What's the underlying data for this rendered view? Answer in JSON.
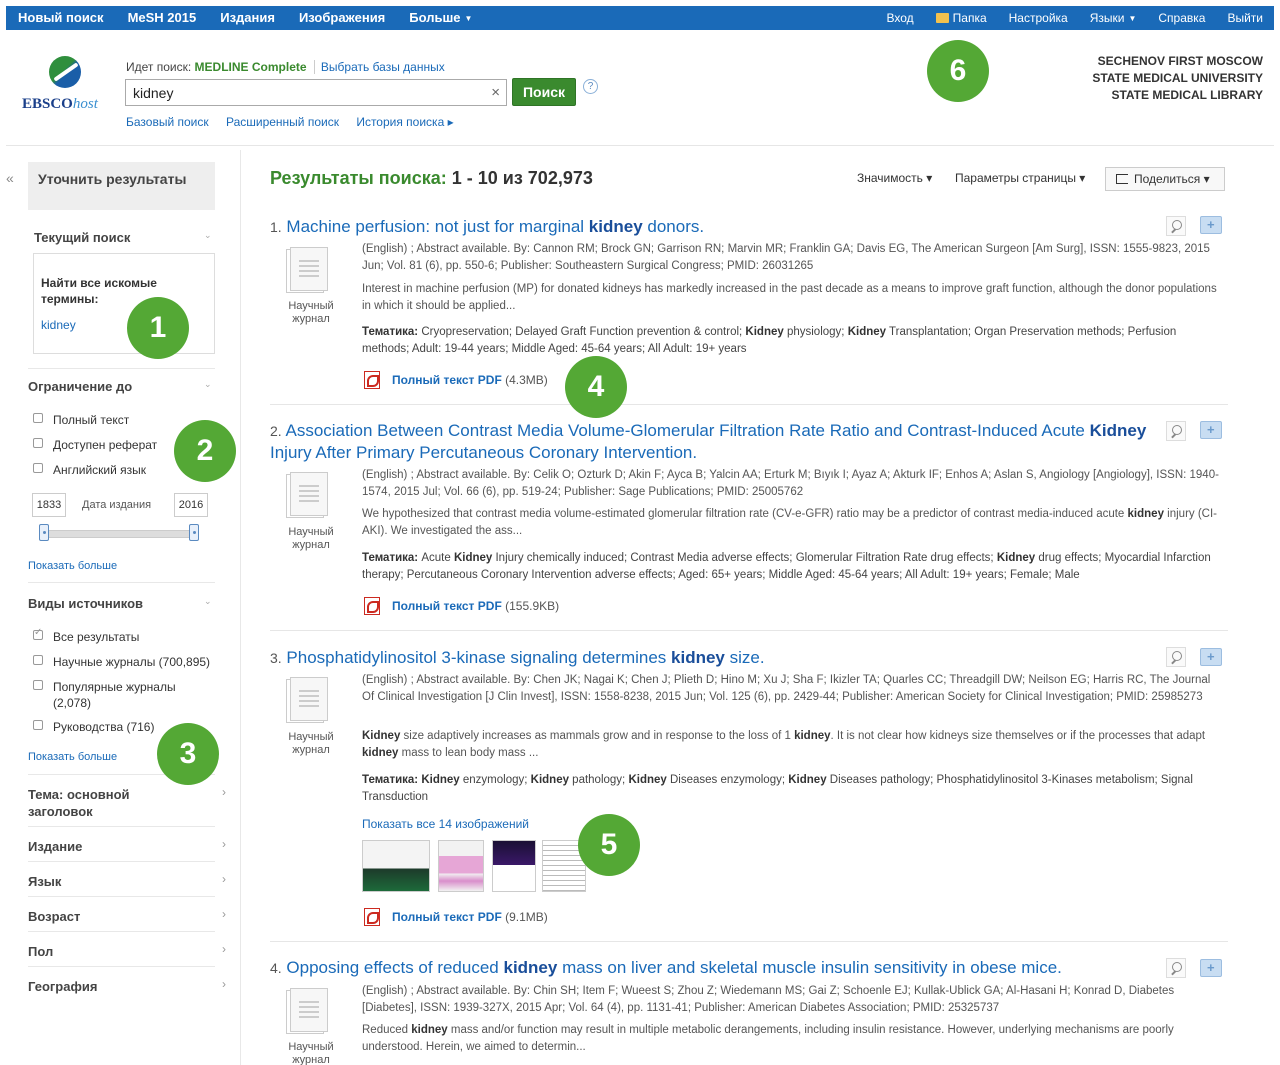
{
  "topnav": {
    "left": [
      "Новый поиск",
      "MeSH 2015",
      "Издания",
      "Изображения",
      "Больше"
    ],
    "right": [
      "Вход",
      "Папка",
      "Настройка",
      "Языки",
      "Справка",
      "Выйти"
    ]
  },
  "header": {
    "logo_main": "EBSCO",
    "logo_host": "host",
    "searching_prefix": "Идет поиск:",
    "database": "MEDLINE Complete",
    "choose_db": "Выбрать базы данных",
    "query": "kidney",
    "clear_glyph": "×",
    "search_button": "Поиск",
    "help_glyph": "?",
    "links": [
      "Базовый поиск",
      "Расширенный поиск",
      "История поиска ▸"
    ],
    "institution": [
      "SECHENOV FIRST MOSCOW",
      "STATE MEDICAL UNIVERSITY",
      "STATE MEDICAL LIBRARY"
    ]
  },
  "badges": [
    "1",
    "2",
    "3",
    "4",
    "5",
    "6"
  ],
  "sidebar": {
    "collapse": "«",
    "refine_title": "Уточнить результаты",
    "current_search": "Текущий поиск",
    "find_all_label": "Найти все искомые термины:",
    "term": "kidney",
    "limit_to": "Ограничение до",
    "limits": [
      "Полный текст",
      "Доступен реферат",
      "Английский язык"
    ],
    "date_from": "1833",
    "date_label": "Дата издания",
    "date_to": "2016",
    "show_more": "Показать больше",
    "source_types": "Виды источников",
    "sources": [
      "Все результаты",
      "Научные журналы (700,895)",
      "Популярные журналы",
      "(2,078)",
      "Руководства (716)"
    ],
    "facets": [
      "Тема: основной",
      "заголовок",
      "Издание",
      "Язык",
      "Возраст",
      "Пол",
      "География"
    ],
    "chevron_down": "⌄",
    "chevron_right": "›"
  },
  "results": {
    "title_prefix": "Результаты поиска:",
    "title_count": "1 - 10 из 702,973",
    "sort": "Значимость ▾",
    "page_options": "Параметры страницы ▾",
    "share": "Поделиться ▾",
    "pub_type_line1": "Научный",
    "pub_type_line2": "журнал",
    "pdf_label": "Полный текст PDF",
    "subjects_label": "Тематика:",
    "items": [
      {
        "num": "1.",
        "title_parts": [
          "Machine perfusion: not just for marginal ",
          "kidney",
          " donors."
        ],
        "meta": "(English) ; Abstract available. By: Cannon RM; Brock GN; Garrison RN; Marvin MR; Franklin GA; Davis EG, The American Surgeon [Am Surg], ISSN: 1555-9823, 2015 Jun; Vol. 81 (6), pp. 550-6; Publisher: Southeastern Surgical Congress; PMID: 26031265",
        "abstract": "Interest in machine perfusion (MP) for donated kidneys has markedly increased in the past decade as a means to improve graft function, although the donor populations in which it should be applied...",
        "subjects_parts": [
          "Cryopreservation; Delayed Graft Function prevention & control; ",
          "Kidney",
          " physiology; ",
          "Kidney",
          " Transplantation; Organ Preservation methods; Perfusion methods; Adult: 19-44 years; Middle Aged: 45-64 years; All Adult: 19+ years"
        ],
        "pdf_size": "(4.3MB)"
      },
      {
        "num": "2.",
        "title_parts": [
          "Association Between Contrast Media Volume-Glomerular Filtration Rate Ratio and Contrast-Induced Acute ",
          "Kidney",
          " Injury After Primary Percutaneous Coronary Intervention."
        ],
        "meta": "(English) ; Abstract available. By: Celik O; Ozturk D; Akin F; Ayca B; Yalcin AA; Erturk M; Bıyık I; Ayaz A; Akturk IF; Enhos A; Aslan S, Angiology [Angiology], ISSN: 1940-1574, 2015 Jul; Vol. 66 (6), pp. 519-24; Publisher: Sage Publications; PMID: 25005762",
        "abstract_parts": [
          "We hypothesized that contrast media volume-estimated glomerular filtration rate (CV-e-GFR) ratio may be a predictor of contrast media-induced acute ",
          "kidney",
          " injury (CI-AKI). We investigated the ass..."
        ],
        "subjects_parts": [
          "Acute ",
          "Kidney",
          " Injury chemically induced; Contrast Media adverse effects; Glomerular Filtration Rate drug effects; ",
          "Kidney",
          " drug effects; Myocardial Infarction therapy; Percutaneous Coronary Intervention adverse effects; Aged: 65+ years; Middle Aged: 45-64 years; All Adult: 19+ years; Female; Male"
        ],
        "pdf_size": "(155.9KB)"
      },
      {
        "num": "3.",
        "title_parts": [
          "Phosphatidylinositol 3-kinase signaling determines ",
          "kidney",
          " size."
        ],
        "meta": "(English) ; Abstract available. By: Chen JK; Nagai K; Chen J; Plieth D; Hino M; Xu J; Sha F; Ikizler TA; Quarles CC; Threadgill DW; Neilson EG; Harris RC, The Journal Of Clinical Investigation [J Clin Invest], ISSN: 1558-8238, 2015 Jun; Vol. 125 (6), pp. 2429-44; Publisher: American Society for Clinical Investigation; PMID: 25985273",
        "abstract_parts": [
          "Kidney",
          " size adaptively increases as mammals grow and in response to the loss of 1 ",
          "kidney",
          ". It is not clear how kidneys size themselves or if the processes that adapt ",
          "kidney",
          " mass to lean body mass ..."
        ],
        "subjects_parts": [
          "",
          "Kidney",
          " enzymology; ",
          "Kidney",
          " pathology; ",
          "Kidney",
          " Diseases enzymology; ",
          "Kidney",
          " Diseases pathology; Phosphatidylinositol 3-Kinases metabolism; Signal Transduction"
        ],
        "images_link": "Показать все 14 изображений",
        "pdf_size": "(9.1MB)"
      },
      {
        "num": "4.",
        "title_parts": [
          "Opposing effects of reduced ",
          "kidney",
          " mass on liver and skeletal muscle insulin sensitivity in obese mice."
        ],
        "meta": "(English) ; Abstract available. By: Chin SH; Item F; Wueest S; Zhou Z; Wiedemann MS; Gai Z; Schoenle EJ; Kullak-Ublick GA; Al-Hasani H; Konrad D, Diabetes [Diabetes], ISSN: 1939-327X, 2015 Apr; Vol. 64 (4), pp. 1131-41; Publisher: American Diabetes Association; PMID: 25325737",
        "abstract_parts": [
          "Reduced ",
          "kidney",
          " mass and/or function may result in multiple metabolic derangements, including insulin resistance. However, underlying mechanisms are poorly understood. Herein, we aimed to determin..."
        ]
      }
    ]
  },
  "colors": {
    "topbar": "#1a6ab8",
    "accent_green": "#3a8a2e",
    "badge_green": "#54a835",
    "link": "#1a6ab8"
  }
}
